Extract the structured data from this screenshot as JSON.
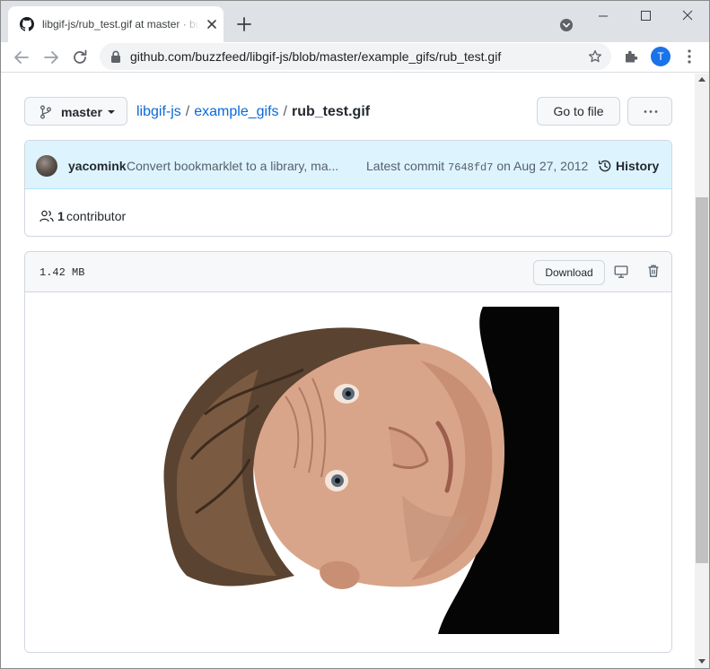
{
  "browser": {
    "tab": {
      "title": "libgif-js/rub_test.gif at master · buzzfeed/libgif-js"
    },
    "window_controls": {
      "minimize": "—",
      "maximize": "☐",
      "close": "✕"
    },
    "omnibox": {
      "url": "github.com/buzzfeed/libgif-js/blob/master/example_gifs/rub_test.gif"
    },
    "profile": {
      "initial": "T",
      "color": "#1a73e8"
    }
  },
  "file_nav": {
    "branch": "master",
    "breadcrumb": {
      "repo": "libgif-js",
      "separator": "/",
      "folder": "example_gifs",
      "file": "rub_test.gif"
    },
    "go_to_file": "Go to file",
    "more": "···"
  },
  "commit": {
    "author": "yacomink",
    "message": "Convert bookmarklet to a library, ma...",
    "prefix": "Latest commit",
    "sha": "7648fd7",
    "date": "on Aug 27, 2012",
    "history": "History"
  },
  "contributors": {
    "count": "1",
    "label": "contributor"
  },
  "file": {
    "size": "1.42 MB",
    "download": "Download"
  },
  "colors": {
    "link": "#0969da",
    "commit_header_bg": "#ddf4ff",
    "chrome_tabstrip": "#dee1e6"
  }
}
